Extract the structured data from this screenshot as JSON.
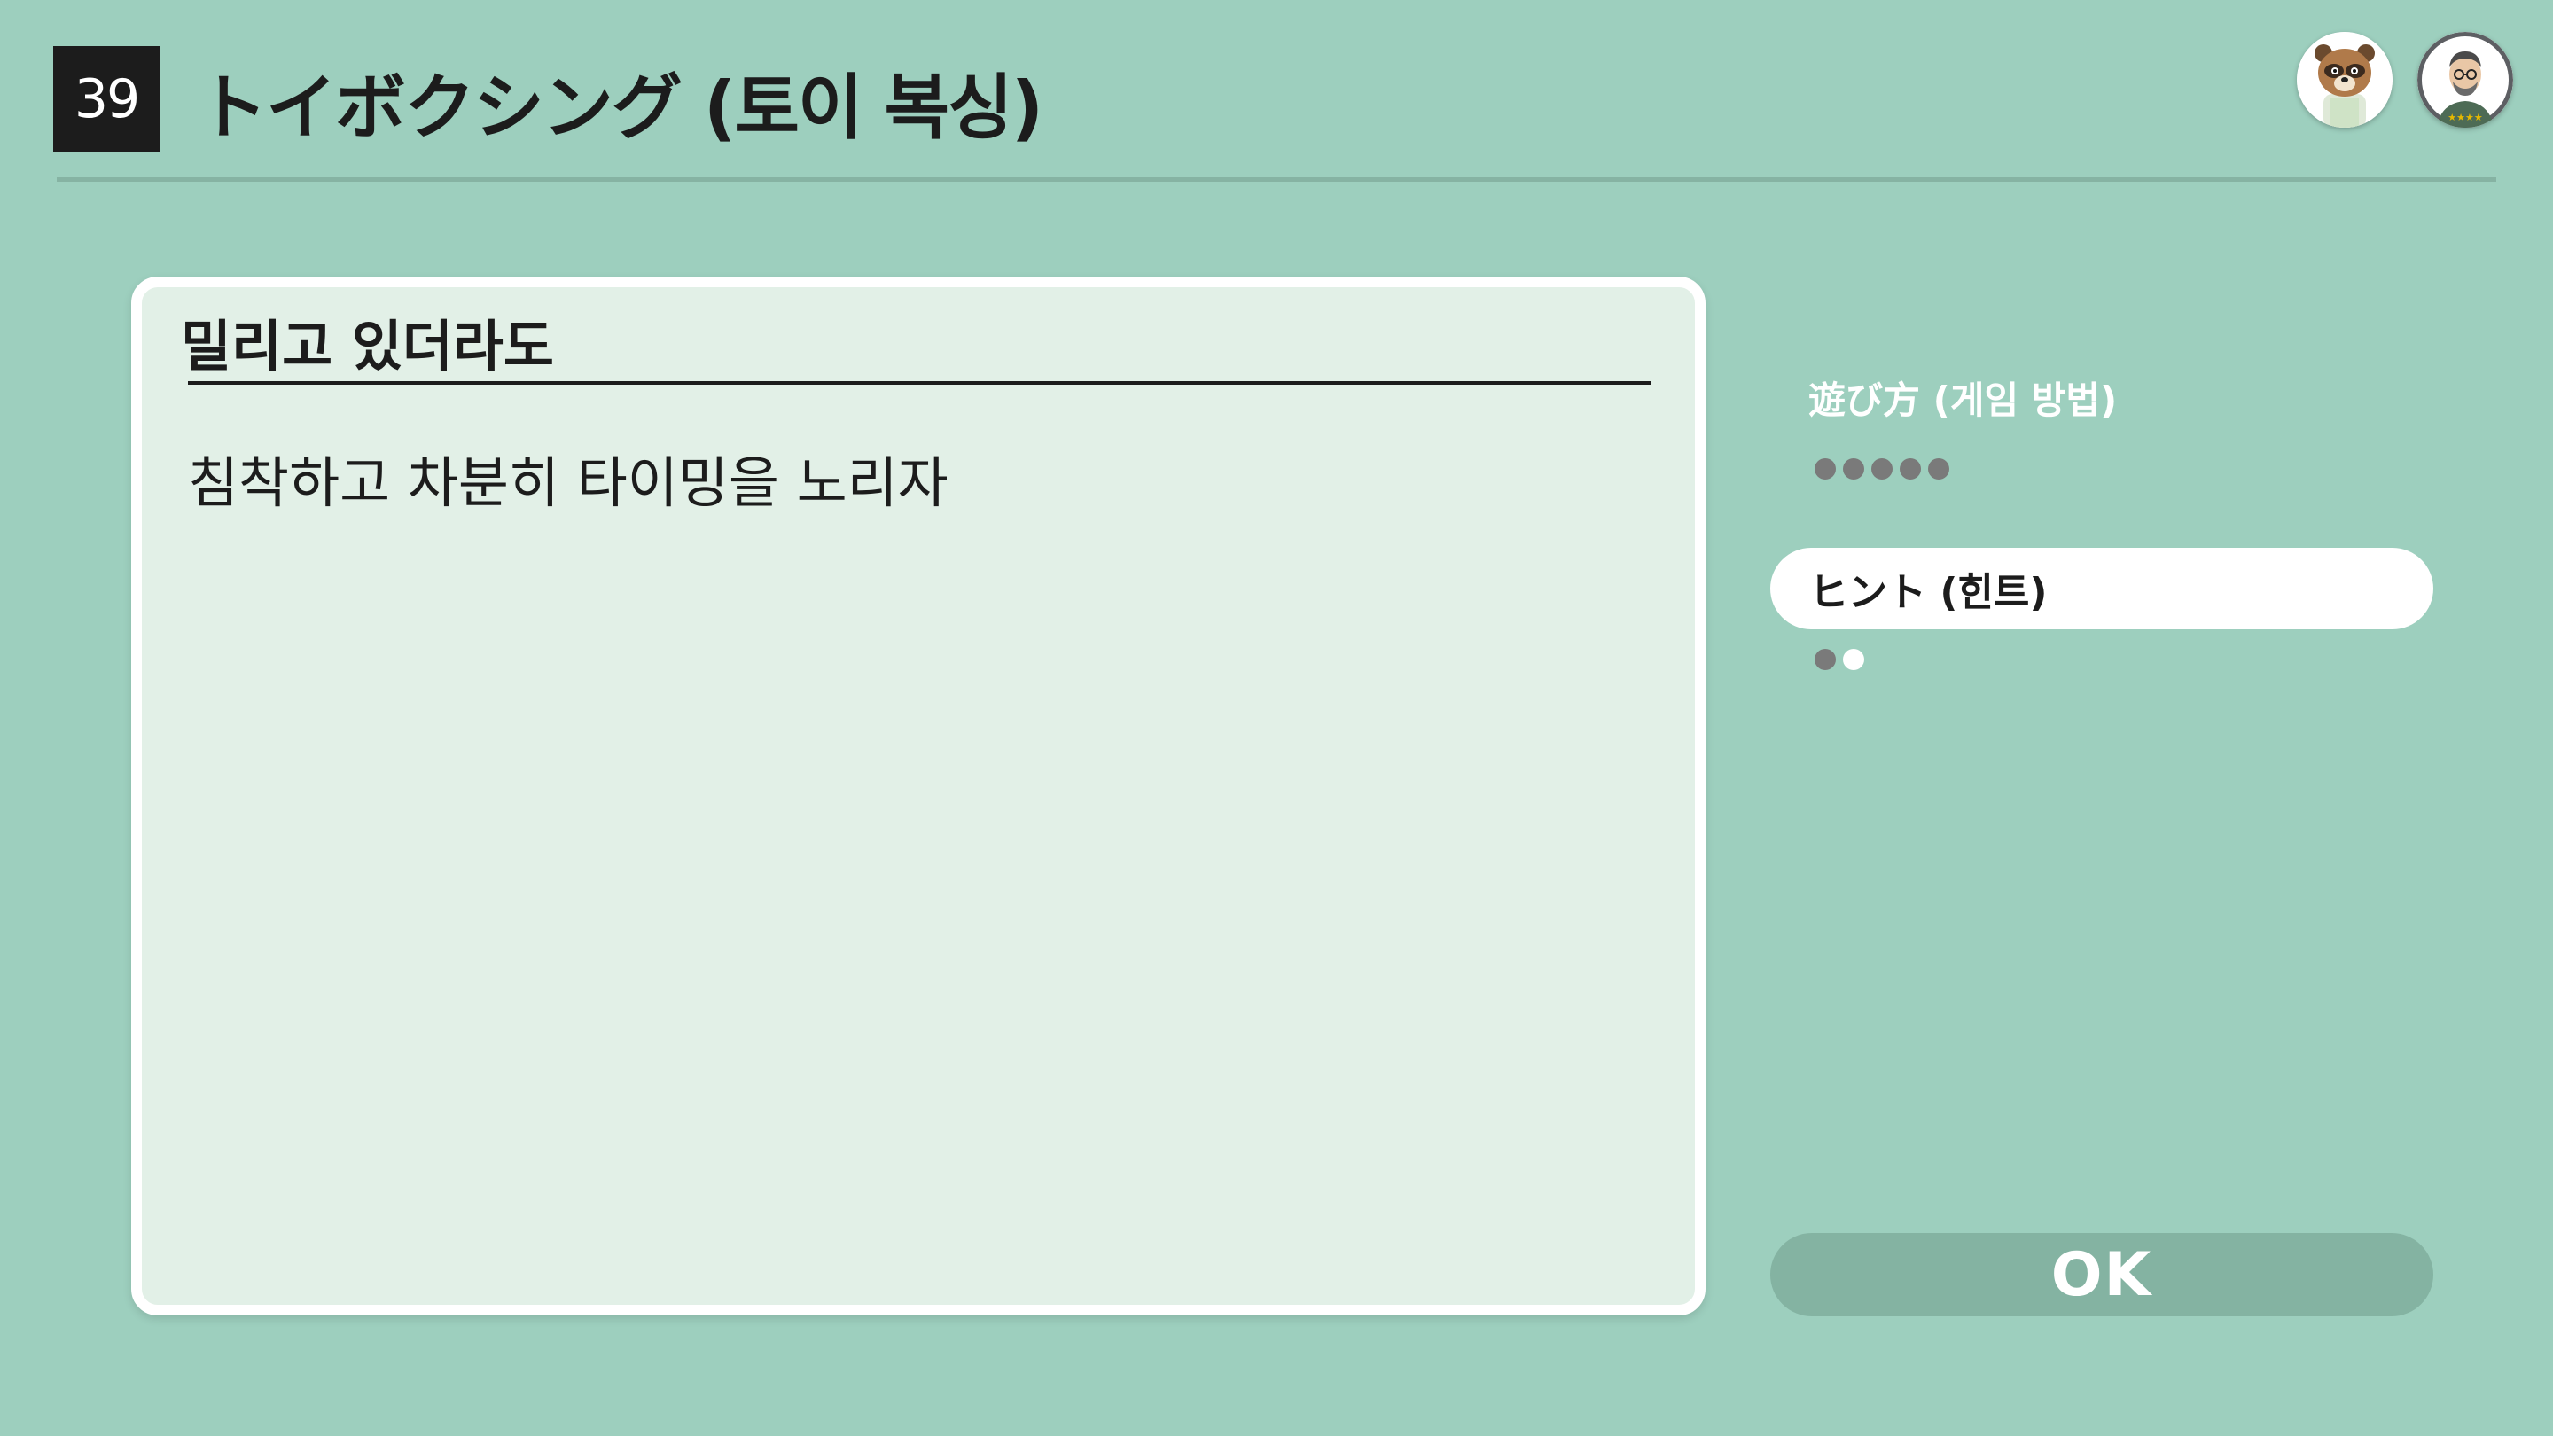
{
  "header": {
    "game_number": "39",
    "game_title": "トイボクシング (토이 복싱)"
  },
  "players": [
    {
      "avatar": "raccoon-character-avatar"
    },
    {
      "avatar": "mii-character-avatar"
    }
  ],
  "hint_card": {
    "heading": "밀리고 있더라도",
    "body": "침착하고 차분히 타이밍을 노리자"
  },
  "menu": {
    "howto": {
      "label": "遊び方 (게임 방법)",
      "pages_total": 5,
      "current_page": 0
    },
    "hint": {
      "label": "ヒント (힌트)",
      "pages_total": 2,
      "current_page": 2,
      "selected": true
    },
    "ok_label": "OK"
  },
  "colors": {
    "background": "#9dcfbe",
    "card": "#e2f0e7",
    "ok_button": "#84b3a2",
    "dot_inactive": "#7a7a7a",
    "dot_active": "#ffffff"
  }
}
